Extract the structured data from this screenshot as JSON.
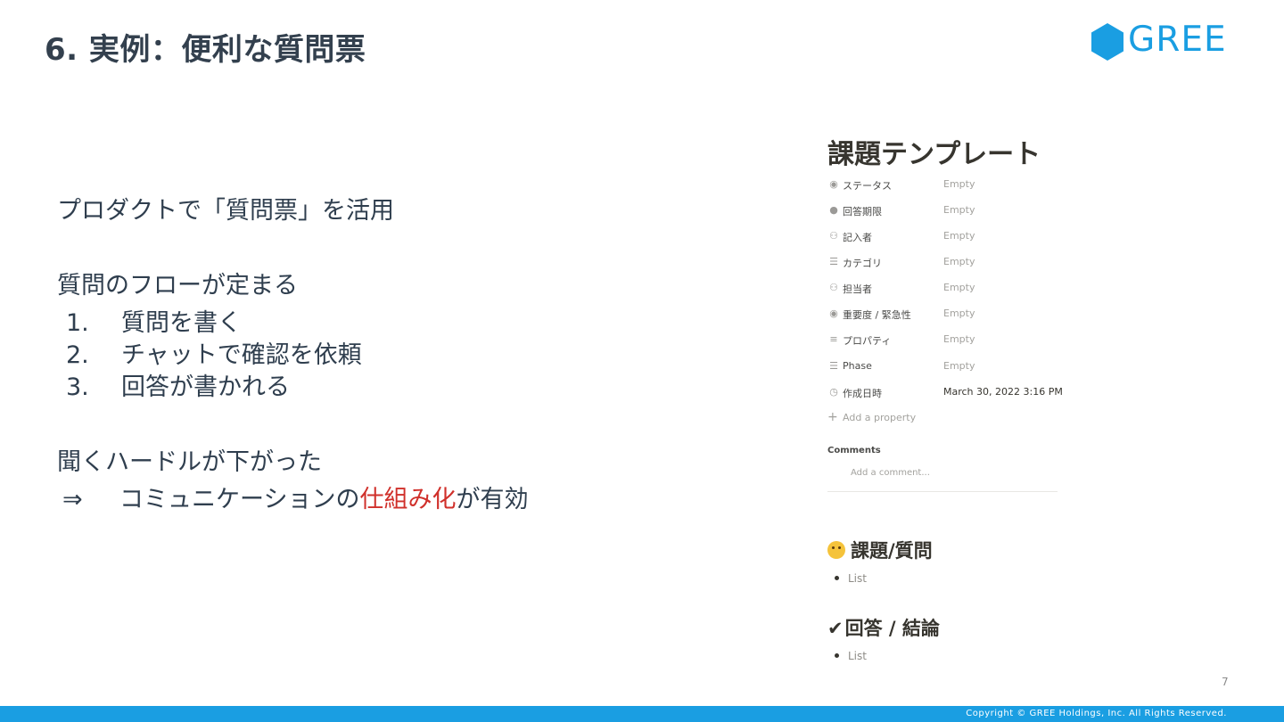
{
  "slide": {
    "title": "6. 実例：便利な質問票",
    "page_number": "7",
    "copyright": "Copyright © GREE Holdings, Inc. All Rights Reserved."
  },
  "logo": {
    "text": "GREE",
    "brand_color": "#1a9ee2",
    "icon": "hexagon-icon"
  },
  "content": {
    "line1": "プロダクトで「質問票」を活用",
    "line2": "質問のフローが定まる",
    "steps": [
      {
        "num": "1.",
        "text": "質問を書く"
      },
      {
        "num": "2.",
        "text": "チャットで確認を依頼"
      },
      {
        "num": "3.",
        "text": "回答が書かれる"
      }
    ],
    "line3": "聞くハードルが下がった",
    "conclusion": {
      "arrow": "⇒",
      "before": "コミュニケーションの",
      "highlight": "仕組み化",
      "after": "が有効"
    }
  },
  "colors": {
    "highlight": "#d0302b",
    "text": "#2f3e4e",
    "footer": "#1a9ee2"
  },
  "notion_panel": {
    "title": "課題テンプレート",
    "properties": [
      {
        "icon": "status-icon",
        "name": "ステータス",
        "value": "Empty"
      },
      {
        "icon": "clock-icon",
        "name": "回答期限",
        "value": "Empty"
      },
      {
        "icon": "people-icon",
        "name": "記入者",
        "value": "Empty"
      },
      {
        "icon": "list-icon",
        "name": "カテゴリ",
        "value": "Empty"
      },
      {
        "icon": "people-icon",
        "name": "担当者",
        "value": "Empty"
      },
      {
        "icon": "status-icon",
        "name": "重要度 / 緊急性",
        "value": "Empty"
      },
      {
        "icon": "text-icon",
        "name": "プロパティ",
        "value": "Empty"
      },
      {
        "icon": "list-icon",
        "name": "Phase",
        "value": "Empty"
      },
      {
        "icon": "clock-outline-icon",
        "name": "作成日時",
        "value": "March 30, 2022 3:16 PM"
      }
    ],
    "add_property": "Add a property",
    "comments_label": "Comments",
    "comment_placeholder": "Add a comment...",
    "section1": {
      "emoji": "thinking-face-icon",
      "heading": "課題/質問",
      "bullet": "List"
    },
    "section2": {
      "check": "✔",
      "heading": "回答 / 結論",
      "bullet": "List"
    }
  }
}
